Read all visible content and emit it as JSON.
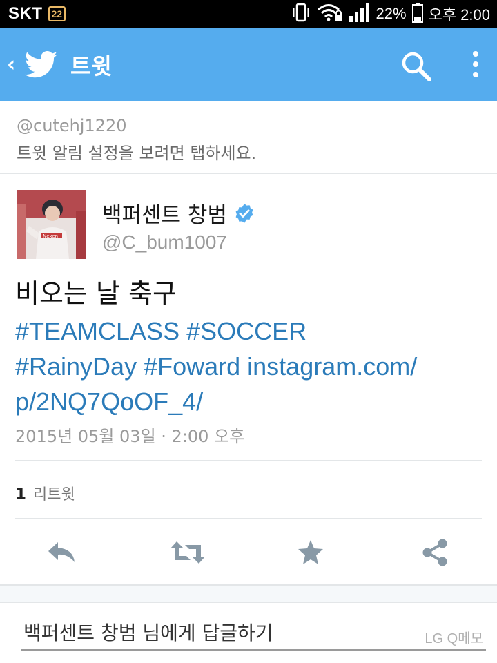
{
  "status_bar": {
    "carrier": "SKT",
    "badge": "22",
    "battery": "22%",
    "time": "오후 2:00"
  },
  "app_bar": {
    "back_glyph": "‹",
    "title": "트윗",
    "icons": [
      "chevron-left-icon",
      "twitter-bird-icon",
      "search-icon",
      "more-vertical-icon"
    ]
  },
  "notification": {
    "handle": "@cutehj1220",
    "text": "트윗 알림 설정을 보려면 탭하세요."
  },
  "tweet": {
    "author_name": "백퍼센트 창범",
    "verified": true,
    "author_handle": "@C_bum1007",
    "text": "비오는 날 축구",
    "links": {
      "line1": "#TEAMCLASS #SOCCER",
      "line2": "#RainyDay #Foward instagram.com/",
      "line3": "p/2NQ7QoOF_4/"
    },
    "date": "2015년 05월 03일 · 2:00 오후",
    "retweet_count": "1",
    "retweet_label": "리트윗",
    "actions": [
      "reply-icon",
      "retweet-icon",
      "favorite-star-icon",
      "share-icon"
    ]
  },
  "reply": {
    "placeholder": "백퍼센트 창범 님에게 답글하기",
    "memo_label": "LG Q메모"
  },
  "colors": {
    "app_bar": "#55acee",
    "link": "#2b7bb9",
    "icon_gray": "#8899a6",
    "verified": "#55acee"
  }
}
